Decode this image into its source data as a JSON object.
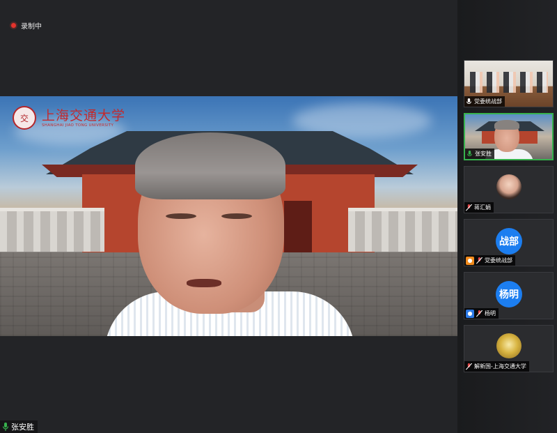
{
  "recording": {
    "label": "录制中",
    "dot_color": "#e5332c"
  },
  "main_video": {
    "speaker_name": "张安胜",
    "mic_icon": "mic-on-icon",
    "background": {
      "logo_cn": "上海交通大学",
      "logo_en": "SHANGHAI JIAO TONG UNIVERSITY",
      "seal_char": "交"
    }
  },
  "participants": [
    {
      "name": "党委统战部",
      "video": "room",
      "mic_icon": "mic-on-icon",
      "role_tag": null
    },
    {
      "name": "张安胜",
      "video": "speaker",
      "mic_icon": "mic-on-icon",
      "active": true
    },
    {
      "name": "蒋汇娟",
      "video": "photo-avatar",
      "mic_icon": "mic-off-icon"
    },
    {
      "name": "党委统战部",
      "avatar_text": "战部",
      "mic_icon": "mic-off-icon",
      "role_tag": "host-icon"
    },
    {
      "name": "杨明",
      "avatar_text": "杨明",
      "mic_icon": "mic-off-icon",
      "role_tag": "user-icon"
    },
    {
      "name": "解新国-上海交通大学",
      "video": "emblem-avatar",
      "mic_icon": "mic-off-icon"
    }
  ],
  "colors": {
    "active_border": "#37b24d",
    "avatar_blue": "#1c7ef0",
    "host_tag": "#f08a1c",
    "user_tag": "#2d7ae6"
  }
}
